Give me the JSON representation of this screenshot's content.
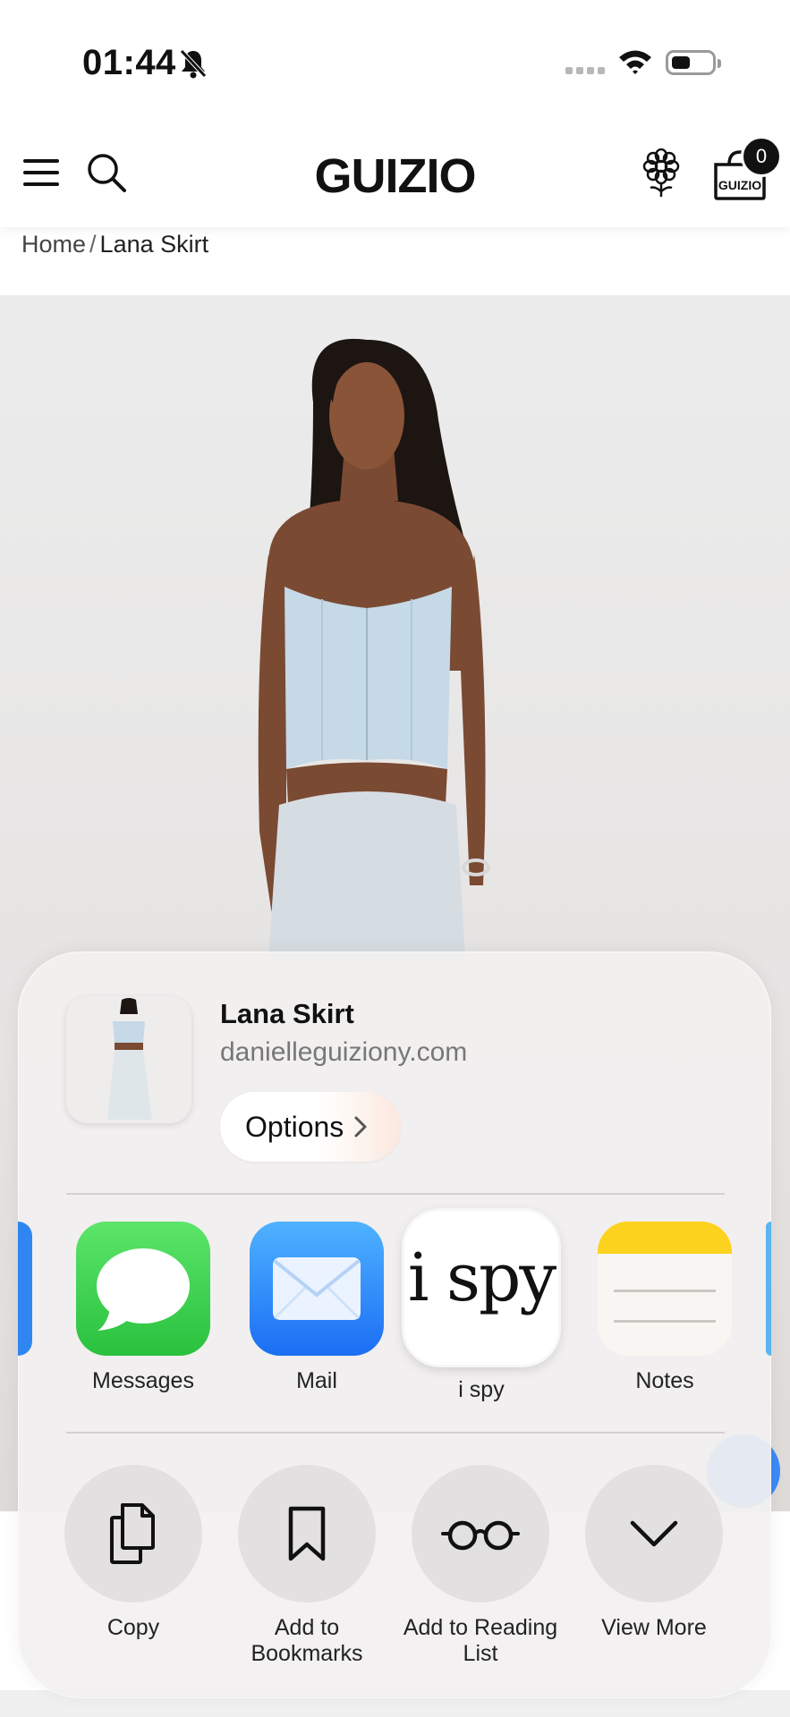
{
  "status_bar": {
    "time": "01:44"
  },
  "header": {
    "brand": "GUIZIO",
    "cart_count": "0",
    "cart_bag_text": "GUIZIO"
  },
  "breadcrumb": {
    "home": "Home",
    "separator": "/",
    "current": "Lana Skirt"
  },
  "share_sheet": {
    "title": "Lana Skirt",
    "domain": "danielleguiziony.com",
    "options_label": "Options",
    "apps": [
      {
        "label": "Messages",
        "icon": "messages-icon"
      },
      {
        "label": "Mail",
        "icon": "mail-icon"
      },
      {
        "label": "i spy",
        "icon": "ispy-icon",
        "icon_text": "i spy"
      },
      {
        "label": "Notes",
        "icon": "notes-icon"
      }
    ],
    "actions": [
      {
        "label": "Copy",
        "icon": "copy-icon"
      },
      {
        "label": "Add to Bookmarks",
        "icon": "bookmark-icon"
      },
      {
        "label": "Add to Reading List",
        "icon": "glasses-icon"
      },
      {
        "label": "View More",
        "icon": "chevron-down-icon"
      }
    ]
  },
  "colors": {
    "messages_green": "#34c759",
    "mail_blue": "#1b6ef4",
    "notes_yellow": "#fdd21f",
    "top_light_blue": "#c5d9e6"
  }
}
